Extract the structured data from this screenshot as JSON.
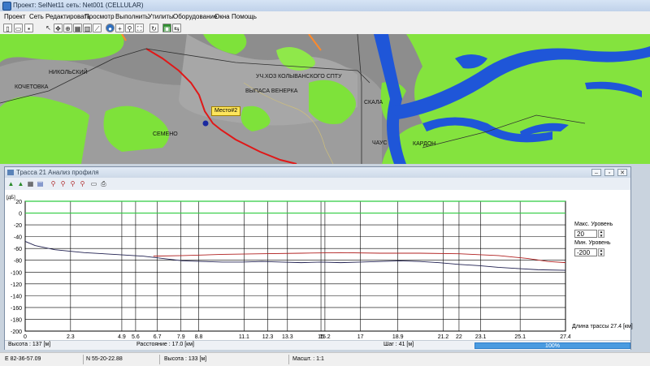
{
  "title": "Проект: SelNet11  сеть: Net001 (CELLULAR)",
  "menu": [
    "Проект",
    "Сеть",
    "Редактировать",
    "Просмотр",
    "Выполнить",
    "Утилиты",
    "Оборудование",
    "Окна",
    "Помощь"
  ],
  "map": {
    "labels": [
      "НИКОЛЬСКИЙ",
      "КОЧЕТОВКА",
      "УЧ.ХОЗ КОЛЫВАНСКОГО СПТУ",
      "ВЫПАСА ВЕНЕРКА",
      "СЕМЕНО",
      "СКАЛА",
      "ЧАУС",
      "КАРДОН"
    ],
    "callout": "Место#2"
  },
  "profile_window": {
    "title": "Трасса 21 Анализ профиля",
    "max_level_label": "Макс. Уровень",
    "max_level_value": "20",
    "min_level_label": "Мин. Уровень",
    "min_level_value": "-200",
    "route_length": "Длина трассы 27.4 [км]",
    "units_x": "[км]",
    "status": {
      "height": "Высота : 137 [м]",
      "distance": "Расстояние : 17.0 [км]",
      "step": "Шаг : 41 [м]",
      "progress": "100%"
    }
  },
  "chart_data": {
    "type": "line",
    "ylabel": "[дБ]",
    "ylim": [
      -200,
      20
    ],
    "xlim": [
      0,
      27.4
    ],
    "yticks": [
      20,
      0,
      -20,
      -40,
      -60,
      -80,
      -100,
      -120,
      -140,
      -160,
      -180,
      -200
    ],
    "xticks": [
      0,
      2.3,
      4.9,
      5.6,
      6.7,
      7.9,
      8.8,
      11.1,
      12.3,
      13.3,
      15.0,
      15.2,
      17.0,
      18.9,
      21.2,
      22.0,
      23.1,
      25.1,
      27.4
    ],
    "reference_line": 0,
    "series": [
      {
        "color": "#b02020",
        "x": [
          6.5,
          8,
          10,
          12,
          14,
          16,
          18,
          20,
          22,
          24,
          25.5,
          26.5,
          27.4
        ],
        "y": [
          -73,
          -72,
          -70,
          -69,
          -68,
          -67,
          -68,
          -68,
          -69,
          -72,
          -77,
          -82,
          -84
        ]
      },
      {
        "color": "#202050",
        "x": [
          0,
          0.5,
          1.5,
          3,
          4.5,
          6,
          7,
          8,
          9,
          10,
          11,
          12,
          13,
          14,
          15,
          16,
          17,
          18,
          19,
          20,
          21,
          22,
          23,
          24,
          25,
          26,
          27.4
        ],
        "y": [
          -48,
          -55,
          -62,
          -67,
          -70,
          -73,
          -77,
          -81,
          -82,
          -83,
          -83,
          -82,
          -83,
          -84,
          -83,
          -84,
          -83,
          -82,
          -81,
          -82,
          -84,
          -87,
          -89,
          -92,
          -94,
          -96,
          -97
        ]
      }
    ]
  },
  "statusbar": [
    "E 82-36-57.09",
    "N 55-20-22.88",
    "Высота :  133 [м]",
    "Масшт. : 1:1"
  ],
  "colors": {
    "accent": "#4a9be0",
    "map_green": "#7ee23a",
    "map_water": "#1f56d8",
    "route": "#e01818"
  }
}
